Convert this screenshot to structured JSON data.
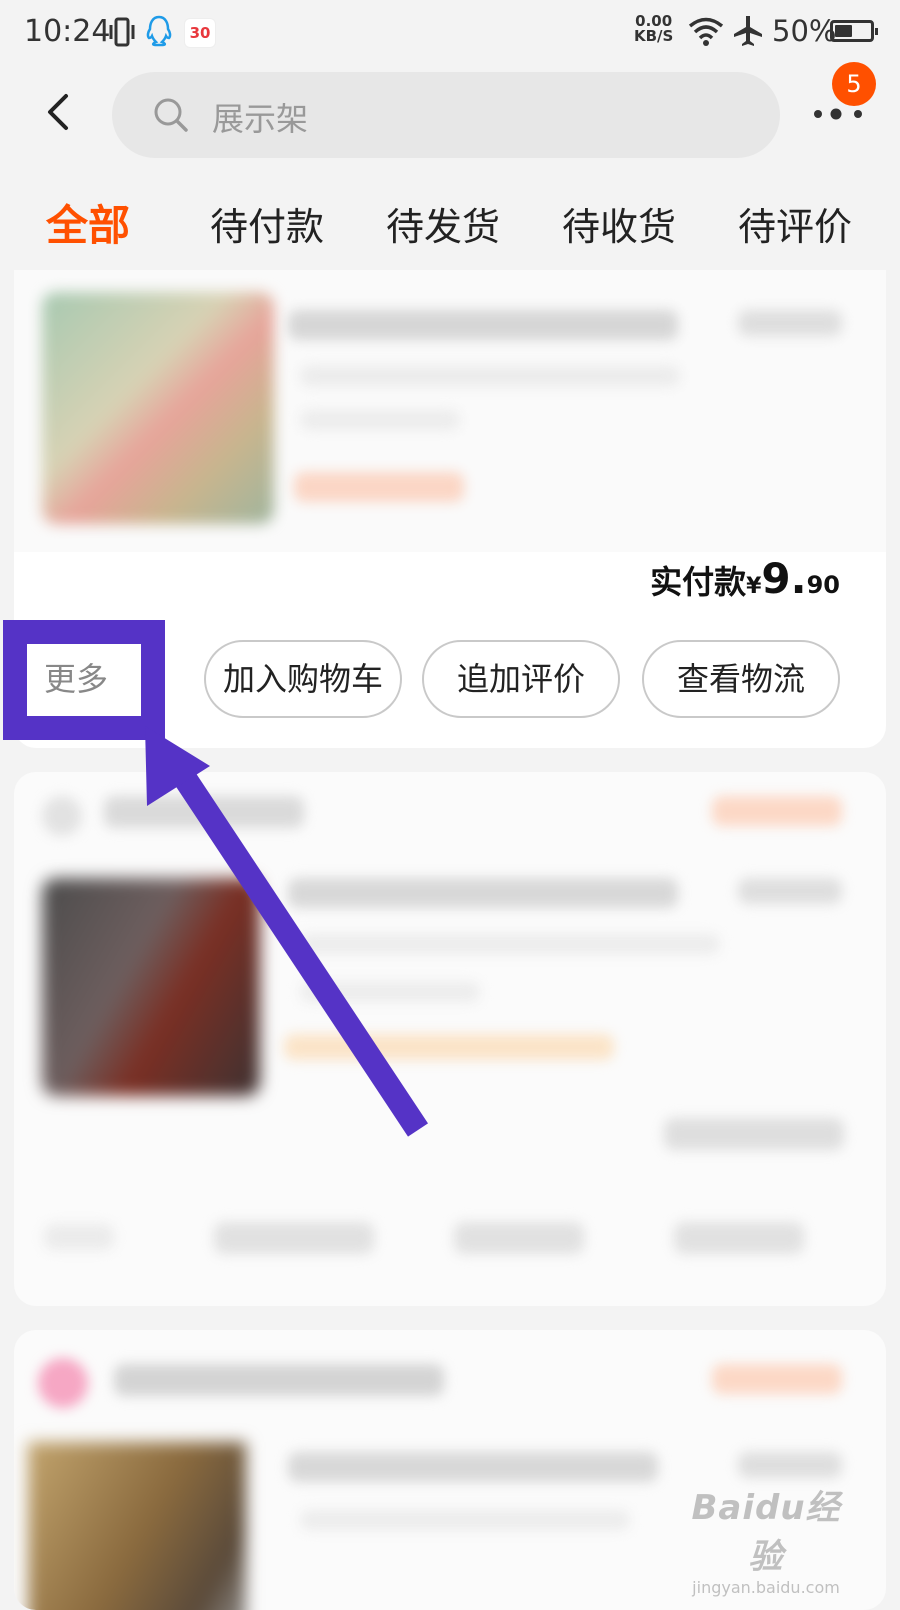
{
  "status_bar": {
    "time": "10:24",
    "notification_badge": "30",
    "net_speed_value": "0.00",
    "net_speed_unit": "KB/S",
    "battery_text": "50%",
    "battery_level": 0.5
  },
  "nav": {
    "search_placeholder": "展示架",
    "badge_count": "5"
  },
  "tabs": [
    {
      "label": "全部",
      "active": true
    },
    {
      "label": "待付款",
      "active": false
    },
    {
      "label": "待发货",
      "active": false
    },
    {
      "label": "待收货",
      "active": false
    },
    {
      "label": "待评价",
      "active": false
    }
  ],
  "order": {
    "total_label": "实付款",
    "currency": "¥",
    "total_int": "9.",
    "total_dec": "90",
    "more_label": "更多",
    "actions": [
      "加入购物车",
      "追加评价",
      "查看物流"
    ]
  },
  "watermark": {
    "logo": "Baidu经验",
    "url": "jingyan.baidu.com"
  },
  "colors": {
    "accent": "#ff5000",
    "annotation": "#5533c6"
  }
}
